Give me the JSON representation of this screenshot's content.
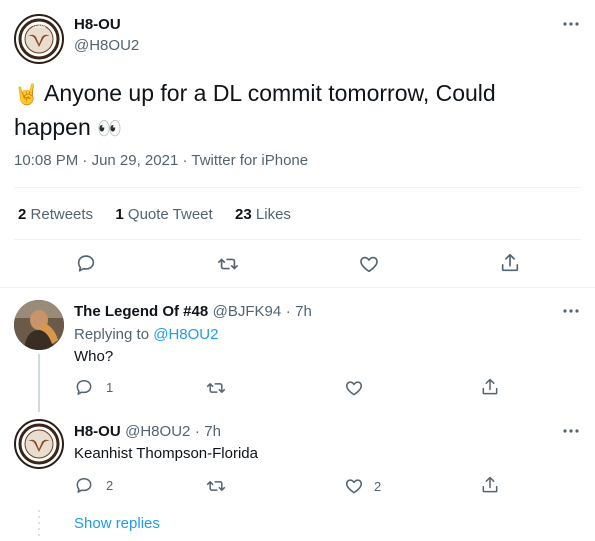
{
  "main_tweet": {
    "name": "H8-OU",
    "handle": "@H8OU2",
    "text_emoji_lead": "🤘",
    "text_line1": "Anyone up for a DL commit tomorrow, Could",
    "text_line2": "happen",
    "text_emoji_tail": "👀",
    "time": "10:08 PM",
    "date": "Jun 29, 2021",
    "source": "Twitter for iPhone",
    "retweets_count": "2",
    "retweets_label": "Retweets",
    "quotes_count": "1",
    "quotes_label": "Quote Tweet",
    "likes_count": "23",
    "likes_label": "Likes"
  },
  "replies": [
    {
      "name": "The Legend Of #48",
      "handle": "@BJFK94",
      "age": "7h",
      "replying_prefix": "Replying to",
      "replying_to": "@H8OU2",
      "text": "Who?",
      "reply_count": "1",
      "retweet_count": "",
      "like_count": ""
    },
    {
      "name": "H8-OU",
      "handle": "@H8OU2",
      "age": "7h",
      "text": "Keanhist Thompson-Florida",
      "reply_count": "2",
      "retweet_count": "",
      "like_count": "2"
    }
  ],
  "show_replies": "Show replies",
  "separator": "·",
  "colors": {
    "text": "#0f1419",
    "secondary": "#536471",
    "link": "#1d9bf0",
    "divider": "#eff3f4"
  }
}
